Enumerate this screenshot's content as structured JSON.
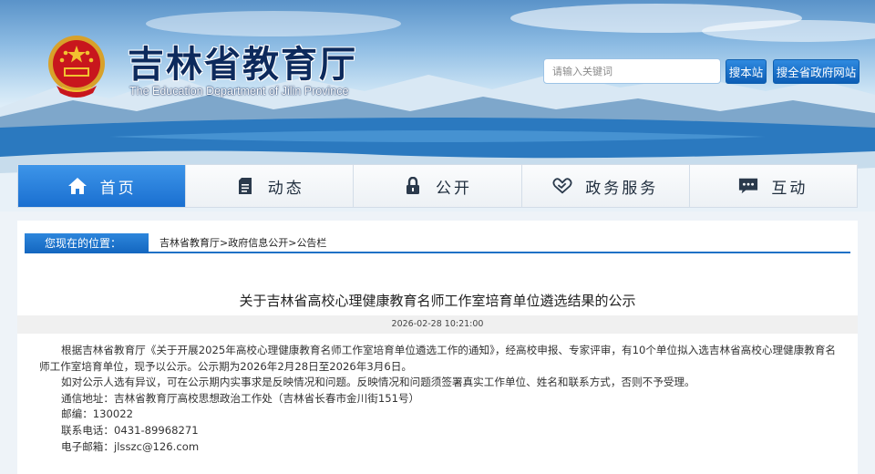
{
  "header": {
    "title": "吉林省教育厅",
    "subtitle": "The Education Department of Jilin Province"
  },
  "search": {
    "placeholder": "请输入关键词",
    "site_button": "搜本站",
    "gov_button": "搜全省政府网站"
  },
  "nav": {
    "items": [
      {
        "label": "首页",
        "icon": "home-icon"
      },
      {
        "label": "动态",
        "icon": "document-icon"
      },
      {
        "label": "公开",
        "icon": "lock-icon"
      },
      {
        "label": "政务服务",
        "icon": "handshake-icon"
      },
      {
        "label": "互动",
        "icon": "chat-icon"
      }
    ]
  },
  "breadcrumb": {
    "label": "您现在的位置：",
    "items": [
      "吉林省教育厅",
      "政府信息公开",
      "公告栏"
    ],
    "separator": ">"
  },
  "article": {
    "title": "关于吉林省高校心理健康教育名师工作室培育单位遴选结果的公示",
    "date": "2026-02-28 10:21:00",
    "para1": "根据吉林省教育厅《关于开展2025年高校心理健康教育名师工作室培育单位遴选工作的通知》，经高校申报、专家评审，有10个单位拟入选吉林省高校心理健康教育名师工作室培育单位，现予以公示。公示期为2026年2月28日至2026年3月6日。",
    "para2": "如对公示人选有异议，可在公示期内实事求是反映情况和问题。反映情况和问题须签署真实工作单位、姓名和联系方式，否则不予受理。",
    "address": "通信地址：吉林省教育厅高校思想政治工作处（吉林省长春市金川街151号）",
    "postcode": "邮编：130022",
    "phone": "联系电话：0431-89968271",
    "email": "电子邮箱：jlsszc@126.com"
  }
}
